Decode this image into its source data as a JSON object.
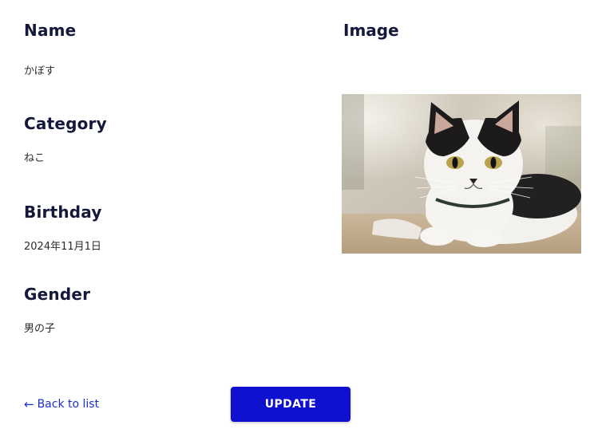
{
  "fields": {
    "name": {
      "label": "Name",
      "value": "かぼす"
    },
    "category": {
      "label": "Category",
      "value": "ねこ"
    },
    "birthday": {
      "label": "Birthday",
      "value": "2024年11月1日"
    },
    "gender": {
      "label": "Gender",
      "value": "男の子"
    }
  },
  "image": {
    "label": "Image",
    "subject": "black-and-white cat lying down"
  },
  "actions": {
    "back_arrow": "←",
    "back_label": "Back to list",
    "update_label": "UPDATE"
  },
  "colors": {
    "heading": "#14183a",
    "link": "#1a2fd0",
    "button": "#1010d0"
  }
}
